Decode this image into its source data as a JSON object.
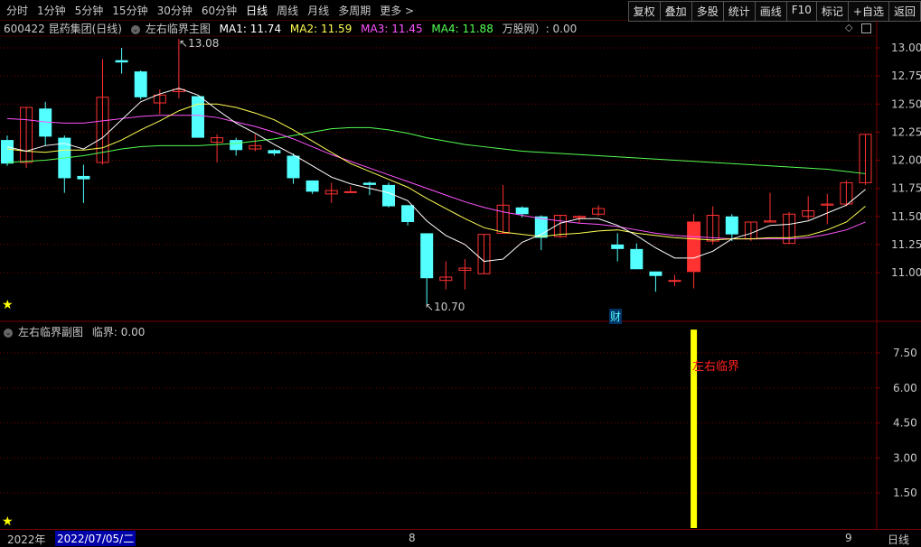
{
  "toolbar": {
    "periods": [
      "分时",
      "1分钟",
      "5分钟",
      "15分钟",
      "30分钟",
      "60分钟",
      "日线",
      "周线",
      "月线",
      "多周期",
      "更多 >"
    ],
    "active_period": "日线",
    "tools": [
      "复权",
      "叠加",
      "多股",
      "统计",
      "画线",
      "F10",
      "标记",
      "+自选",
      "返回"
    ]
  },
  "main_header": {
    "stock": "600422 昆药集团(日线)",
    "indicator": "左右临界主图",
    "ma1": "MA1: 11.74",
    "ma2": "MA2: 11.59",
    "ma3": "MA3: 11.45",
    "ma4": "MA4: 11.88",
    "volume": "万股网）: 0.00"
  },
  "sub_header": {
    "indicator": "左右临界副图",
    "value": "临界: 0.00"
  },
  "annotations": {
    "high": "13.08",
    "low": "10.70",
    "cai": "财",
    "signal": "左右临界"
  },
  "bottom": {
    "year": "2022年",
    "date": "2022/07/05/二",
    "m8": "8",
    "m9": "9",
    "period": "日线"
  },
  "colors": {
    "up": "#ff3232",
    "down": "#54ffff",
    "ma1": "#ffffff",
    "ma2": "#ffff54",
    "ma3": "#ff54ff",
    "ma4": "#54ff54",
    "grid": "#7a0000",
    "signal_bar": "#ffff00"
  },
  "chart_data": {
    "type": "candlestick",
    "main_ylim": [
      10.6,
      13.2
    ],
    "main_ticks": [
      "13.00",
      "12.75",
      "12.50",
      "12.25",
      "12.00",
      "11.75",
      "11.50",
      "11.25",
      "11.00"
    ],
    "sub_ylim": [
      0,
      8.5
    ],
    "sub_ticks": [
      "7.50",
      "6.00",
      "4.50",
      "3.00",
      "1.50"
    ],
    "candles": [
      {
        "o": 12.18,
        "c": 11.97,
        "h": 12.22,
        "l": 11.95
      },
      {
        "o": 11.98,
        "c": 12.47,
        "h": 12.47,
        "l": 11.93
      },
      {
        "o": 12.46,
        "c": 12.21,
        "h": 12.52,
        "l": 12.13
      },
      {
        "o": 12.2,
        "c": 11.84,
        "h": 12.22,
        "l": 11.71
      },
      {
        "o": 11.86,
        "c": 11.83,
        "h": 11.96,
        "l": 11.62
      },
      {
        "o": 11.98,
        "c": 12.56,
        "h": 12.9,
        "l": 11.96
      },
      {
        "o": 12.89,
        "c": 12.87,
        "h": 13.0,
        "l": 12.77
      },
      {
        "o": 12.79,
        "c": 12.56,
        "h": 12.8,
        "l": 12.54
      },
      {
        "o": 12.51,
        "c": 12.58,
        "h": 12.63,
        "l": 12.41
      },
      {
        "o": 12.61,
        "c": 12.63,
        "h": 13.08,
        "l": 12.55
      },
      {
        "o": 12.57,
        "c": 12.2,
        "h": 12.57,
        "l": 12.2
      },
      {
        "o": 12.16,
        "c": 12.2,
        "h": 12.23,
        "l": 11.98
      },
      {
        "o": 12.18,
        "c": 12.09,
        "h": 12.2,
        "l": 12.04
      },
      {
        "o": 12.1,
        "c": 12.13,
        "h": 12.23,
        "l": 12.08
      },
      {
        "o": 12.09,
        "c": 12.06,
        "h": 12.1,
        "l": 12.04
      },
      {
        "o": 12.04,
        "c": 11.84,
        "h": 12.06,
        "l": 11.79
      },
      {
        "o": 11.82,
        "c": 11.72,
        "h": 11.82,
        "l": 11.7
      },
      {
        "o": 11.7,
        "c": 11.73,
        "h": 11.8,
        "l": 11.62
      },
      {
        "o": 11.72,
        "c": 11.72,
        "h": 11.77,
        "l": 11.71
      },
      {
        "o": 11.8,
        "c": 11.78,
        "h": 11.81,
        "l": 11.69
      },
      {
        "o": 11.78,
        "c": 11.59,
        "h": 11.8,
        "l": 11.58
      },
      {
        "o": 11.6,
        "c": 11.45,
        "h": 11.6,
        "l": 11.42
      },
      {
        "o": 11.35,
        "c": 10.95,
        "h": 11.35,
        "l": 10.72
      },
      {
        "o": 10.93,
        "c": 10.96,
        "h": 11.1,
        "l": 10.85
      },
      {
        "o": 11.02,
        "c": 11.04,
        "h": 11.12,
        "l": 10.85
      },
      {
        "o": 10.99,
        "c": 11.34,
        "h": 11.34,
        "l": 10.99
      },
      {
        "o": 11.35,
        "c": 11.6,
        "h": 11.78,
        "l": 11.35
      },
      {
        "o": 11.58,
        "c": 11.52,
        "h": 11.59,
        "l": 11.49
      },
      {
        "o": 11.5,
        "c": 11.31,
        "h": 11.51,
        "l": 11.2
      },
      {
        "o": 11.32,
        "c": 11.51,
        "h": 11.51,
        "l": 11.31
      },
      {
        "o": 11.49,
        "c": 11.5,
        "h": 11.51,
        "l": 11.44
      },
      {
        "o": 11.52,
        "c": 11.57,
        "h": 11.6,
        "l": 11.5
      },
      {
        "o": 11.25,
        "c": 11.21,
        "h": 11.35,
        "l": 11.1
      },
      {
        "o": 11.21,
        "c": 11.03,
        "h": 11.26,
        "l": 11.03
      },
      {
        "o": 11.01,
        "c": 10.97,
        "h": 11.01,
        "l": 10.83
      },
      {
        "o": 10.93,
        "c": 10.93,
        "h": 10.98,
        "l": 10.88
      },
      {
        "o": 11.01,
        "c": 11.45,
        "h": 11.52,
        "l": 10.86
      },
      {
        "o": 11.28,
        "c": 11.51,
        "h": 11.59,
        "l": 11.25
      },
      {
        "o": 11.5,
        "c": 11.34,
        "h": 11.52,
        "l": 11.28
      },
      {
        "o": 11.3,
        "c": 11.45,
        "h": 11.45,
        "l": 11.28
      },
      {
        "o": 11.45,
        "c": 11.46,
        "h": 11.71,
        "l": 11.45
      },
      {
        "o": 11.26,
        "c": 11.52,
        "h": 11.54,
        "l": 11.26
      },
      {
        "o": 11.5,
        "c": 11.55,
        "h": 11.68,
        "l": 11.47
      },
      {
        "o": 11.6,
        "c": 11.61,
        "h": 11.7,
        "l": 11.43
      },
      {
        "o": 11.61,
        "c": 11.8,
        "h": 11.82,
        "l": 11.59
      },
      {
        "o": 11.8,
        "c": 12.23,
        "h": 12.23,
        "l": 11.78
      }
    ],
    "ma1": [
      12.12,
      12.08,
      12.13,
      12.15,
      12.1,
      12.2,
      12.36,
      12.52,
      12.59,
      12.64,
      12.58,
      12.45,
      12.33,
      12.24,
      12.14,
      12.05,
      11.95,
      11.85,
      11.79,
      11.75,
      11.71,
      11.64,
      11.46,
      11.33,
      11.25,
      11.1,
      11.12,
      11.27,
      11.34,
      11.44,
      11.48,
      11.48,
      11.42,
      11.33,
      11.22,
      11.13,
      11.13,
      11.19,
      11.3,
      11.35,
      11.42,
      11.43,
      11.46,
      11.53,
      11.6,
      11.74
    ],
    "ma2": [
      12.1,
      12.08,
      12.07,
      12.09,
      12.09,
      12.11,
      12.18,
      12.27,
      12.35,
      12.44,
      12.5,
      12.5,
      12.47,
      12.42,
      12.36,
      12.27,
      12.17,
      12.07,
      11.97,
      11.9,
      11.83,
      11.76,
      11.66,
      11.57,
      11.48,
      11.4,
      11.36,
      11.34,
      11.32,
      11.34,
      11.35,
      11.37,
      11.38,
      11.35,
      11.33,
      11.31,
      11.3,
      11.29,
      11.3,
      11.3,
      11.31,
      11.31,
      11.33,
      11.38,
      11.45,
      11.59
    ],
    "ma3": [
      12.37,
      12.36,
      12.34,
      12.33,
      12.33,
      12.35,
      12.37,
      12.39,
      12.4,
      12.4,
      12.4,
      12.38,
      12.34,
      12.3,
      12.25,
      12.19,
      12.12,
      12.05,
      11.99,
      11.93,
      11.87,
      11.81,
      11.75,
      11.69,
      11.63,
      11.58,
      11.54,
      11.51,
      11.48,
      11.46,
      11.44,
      11.43,
      11.41,
      11.38,
      11.35,
      11.33,
      11.32,
      11.31,
      11.3,
      11.3,
      11.3,
      11.3,
      11.31,
      11.34,
      11.38,
      11.45
    ],
    "ma4": [
      11.98,
      11.99,
      12.0,
      12.02,
      12.04,
      12.07,
      12.1,
      12.12,
      12.13,
      12.13,
      12.13,
      12.14,
      12.15,
      12.17,
      12.19,
      12.22,
      12.25,
      12.28,
      12.29,
      12.29,
      12.27,
      12.24,
      12.2,
      12.17,
      12.14,
      12.12,
      12.1,
      12.08,
      12.07,
      12.06,
      12.05,
      12.04,
      12.03,
      12.02,
      12.01,
      12.0,
      11.99,
      11.98,
      11.97,
      11.96,
      11.95,
      11.94,
      11.93,
      11.92,
      11.9,
      11.88
    ],
    "signal": {
      "index": 36,
      "value": 8.5
    }
  }
}
